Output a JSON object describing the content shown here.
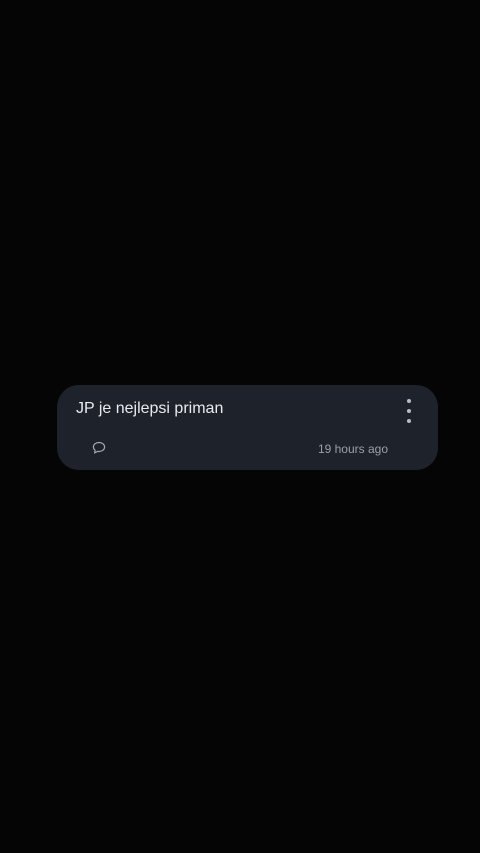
{
  "card": {
    "message": "JP je nejlepsi priman",
    "timestamp": "19 hours ago",
    "icons": {
      "more": "more-vertical-icon",
      "comment": "comment-icon"
    }
  },
  "colors": {
    "background": "#050506",
    "card": "#1d222b",
    "text": "#e8eaee",
    "muted": "#9aa0a8"
  }
}
